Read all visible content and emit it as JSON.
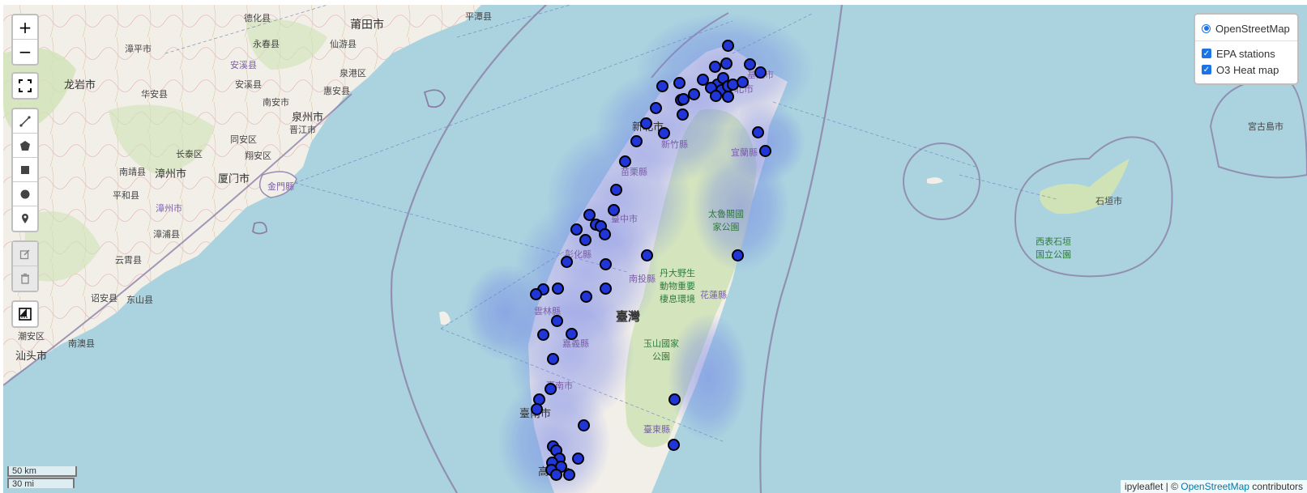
{
  "controls": {
    "zoom_in": "+",
    "zoom_out": "−"
  },
  "layers": {
    "base": "OpenStreetMap",
    "overlays": [
      "EPA stations",
      "O3 Heat map"
    ],
    "overlay_checked": [
      true,
      true
    ]
  },
  "scale": {
    "km": "50 km",
    "mi": "30 mi"
  },
  "attribution": {
    "prefix": "ipyleaflet | © ",
    "link": "OpenStreetMap",
    "suffix": " contributors"
  },
  "colors": {
    "sea": "#aad3df",
    "land": "#f2efe9",
    "heat": "#6f7fe8",
    "station_fill": "#2136d9",
    "accent": "#1a73e8"
  },
  "labels": {
    "putian": "莆田市",
    "zhanghua_town": "德化县",
    "yongchun": "永春县",
    "xianyou": "仙游县",
    "pingtan": "平潭县",
    "zhangping": "漳平市",
    "anxi": "安溪县",
    "huian": "惠安县",
    "quanzhou": "泉州市",
    "nanan": "南安市",
    "quangang": "泉港区",
    "longyan": "龙岩市",
    "huaan": "华安县",
    "tongan": "同安区",
    "jinjiang": "晋江市",
    "changtai": "长泰区",
    "xiamen": "厦门市",
    "zhangzhou": "漳州市",
    "nanjing": "南靖县",
    "pinghe": "平和县",
    "xiangan": "翔安区",
    "zhangpu": "漳浦县",
    "yunxiao": "云霄县",
    "zhaoan": "诏安县",
    "dongshan": "东山县",
    "shantou": "汕头市",
    "nanao": "南澳县",
    "chaoan": "潮安区",
    "jinmen": "金門縣",
    "taipei": "臺北市",
    "keelung": "基隆市",
    "xinbei": "新北市",
    "hsinchu": "新竹縣",
    "yilan": "宜蘭縣",
    "miaoli": "苗栗縣",
    "taichung": "臺中市",
    "taroko": "太魯閣國家公園",
    "changhua": "彰化縣",
    "nantou": "南投縣",
    "danda": "丹大野生動物重要棲息環境",
    "hualien": "花蓮縣",
    "taiwan": "臺灣",
    "yunlin": "雲林縣",
    "chiayi": "嘉義縣",
    "yushan": "玉山國家公園",
    "tainan": "臺南市",
    "taitung": "臺東縣",
    "kaohsiung": "高雄市",
    "ishigaki": "石垣市",
    "iriomote": "西表石垣国立公園",
    "miyako": "宮古島市"
  }
}
